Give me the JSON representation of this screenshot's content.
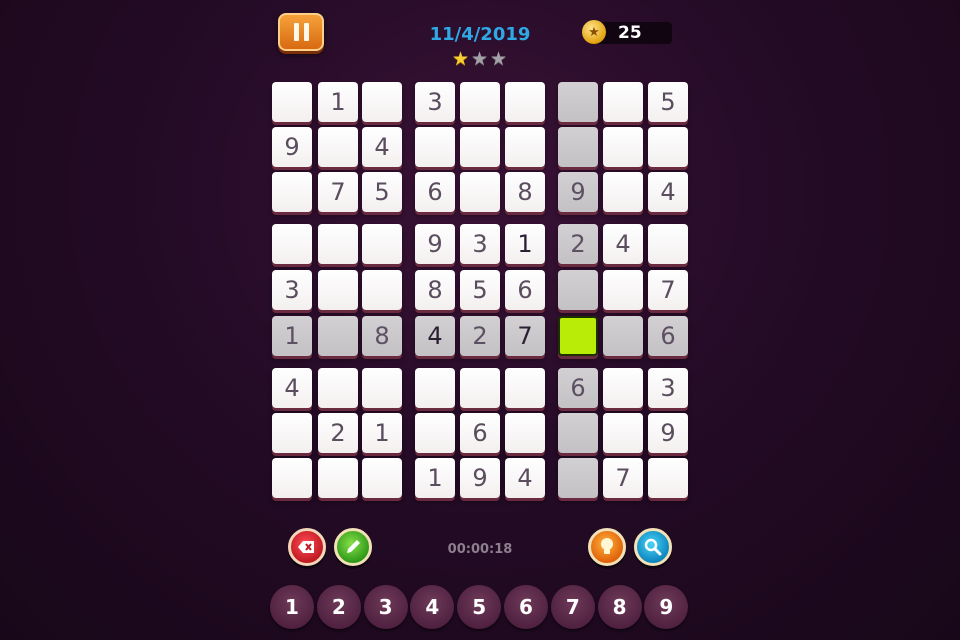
{
  "header": {
    "date": "11/4/2019",
    "stars": [
      "gold",
      "grey",
      "grey"
    ],
    "coins": "25"
  },
  "board": {
    "rows": [
      [
        "",
        "1",
        "",
        "3",
        "",
        "",
        "",
        "",
        "5"
      ],
      [
        "9",
        "",
        "4",
        "",
        "",
        "",
        "",
        "",
        ""
      ],
      [
        "",
        "7",
        "5",
        "6",
        "",
        "8",
        "9",
        "",
        "4"
      ],
      [
        "",
        "",
        "",
        "9",
        "3",
        "1",
        "2",
        "4",
        ""
      ],
      [
        "3",
        "",
        "",
        "8",
        "5",
        "6",
        "",
        "",
        "7"
      ],
      [
        "1",
        "",
        "8",
        "4",
        "2",
        "7",
        "",
        "",
        "6"
      ],
      [
        "4",
        "",
        "",
        "",
        "",
        "",
        "6",
        "",
        "3"
      ],
      [
        "",
        "2",
        "1",
        "",
        "6",
        "",
        "",
        "",
        "9"
      ],
      [
        "",
        "",
        "",
        "1",
        "9",
        "4",
        "",
        "7",
        ""
      ]
    ],
    "selected": [
      5,
      6
    ],
    "highlight_color": "#b9ec06"
  },
  "toolbar": {
    "timer": "00:00:18",
    "erase_icon": "erase-icon",
    "pencil_icon": "pencil-icon",
    "hint_icon": "lightbulb-icon",
    "zoom_icon": "magnifier-icon"
  },
  "numpad": [
    "1",
    "2",
    "3",
    "4",
    "5",
    "6",
    "7",
    "8",
    "9"
  ]
}
